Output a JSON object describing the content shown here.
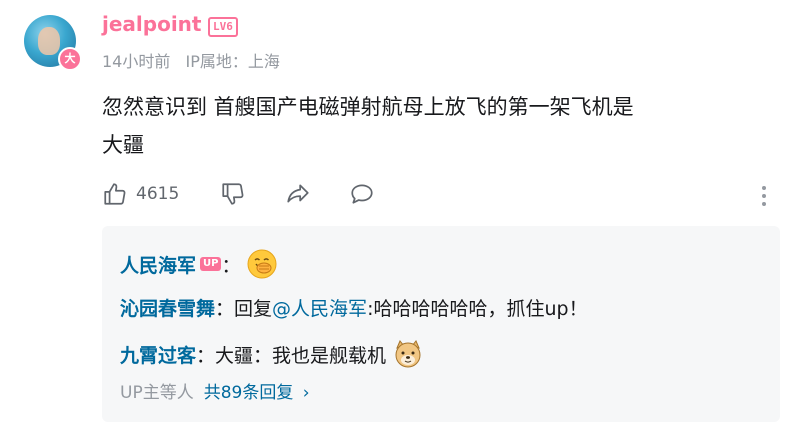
{
  "comment": {
    "username": "jealpoint",
    "level": "LV6",
    "avatar_badge": "大",
    "time": "14小时前",
    "ip_location": "IP属地：上海",
    "text_line1": "忽然意识到 首艘国产电磁弹射航母上放飞的第一架飞机是",
    "text_line2": "大疆"
  },
  "actions": {
    "like_count": "4615",
    "icons": [
      "thumb-up-icon",
      "thumb-down-icon",
      "share-icon",
      "reply-icon",
      "more-vertical-icon"
    ]
  },
  "replies": [
    {
      "name": "人民海军",
      "up_tag": "UP",
      "separator": "：",
      "emoji": "covering-face-emoji"
    },
    {
      "name": "沁园春雪舞",
      "separator": "：",
      "prefix": "回复 ",
      "mention": "@人民海军",
      "text": " :哈哈哈哈哈哈，抓住up！"
    },
    {
      "name": "九霄过客",
      "separator": "：",
      "text": "大疆：我也是舰载机",
      "emoji": "doge-emoji"
    }
  ],
  "replies_footer": {
    "prefix": "UP主等人",
    "total": "共89条回复",
    "chevron": "›"
  },
  "colors": {
    "brand_pink": "#fb7299",
    "link_blue": "#00699d",
    "muted": "#9499a0"
  }
}
